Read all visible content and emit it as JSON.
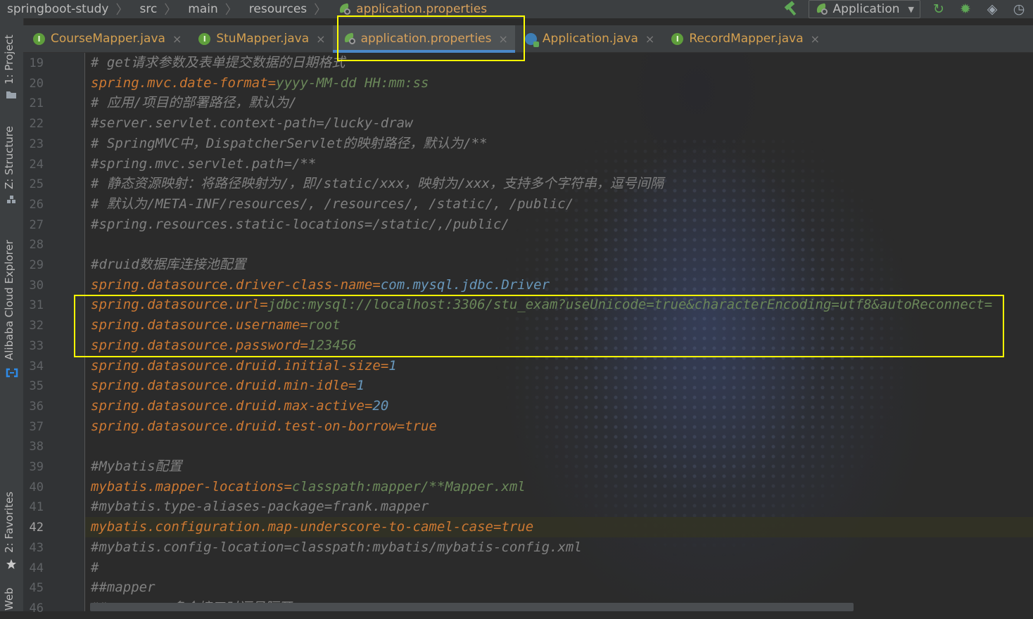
{
  "breadcrumb": {
    "items": [
      {
        "label": "springboot-study"
      },
      {
        "label": "src"
      },
      {
        "label": "main"
      },
      {
        "label": "resources"
      }
    ],
    "active": {
      "label": "application.properties",
      "icon": "spring-leaf-icon"
    }
  },
  "toolbar": {
    "build_icon": "hammer-icon",
    "run_config": {
      "label": "Application",
      "icon": "spring-leaf-icon"
    },
    "actions": [
      {
        "name": "rerun-icon",
        "glyph": "↻"
      },
      {
        "name": "debug-bug-icon",
        "glyph": "✹"
      },
      {
        "name": "coverage-shield-icon",
        "glyph": "◈"
      },
      {
        "name": "profiler-icon",
        "glyph": "◷"
      }
    ]
  },
  "tabs": [
    {
      "label": "CourseMapper.java",
      "icon": "interface-icon",
      "badge": "I",
      "active": false
    },
    {
      "label": "StuMapper.java",
      "icon": "interface-icon",
      "badge": "I",
      "active": false
    },
    {
      "label": "application.properties",
      "icon": "spring-leaf-icon",
      "active": true
    },
    {
      "label": "Application.java",
      "icon": "class-icon",
      "active": false
    },
    {
      "label": "RecordMapper.java",
      "icon": "interface-icon",
      "badge": "I",
      "active": false
    }
  ],
  "close_glyph": "×",
  "tool_windows": {
    "project": "1: Project",
    "structure": "Z: Structure",
    "alibaba": "Alibaba Cloud Explorer",
    "favorites": "2: Favorites",
    "web": "Web"
  },
  "editor": {
    "current_line": 42,
    "line_numbers": [
      19,
      20,
      21,
      22,
      23,
      24,
      25,
      26,
      27,
      28,
      29,
      30,
      31,
      32,
      33,
      34,
      35,
      36,
      37,
      38,
      39,
      40,
      41,
      42,
      43,
      44,
      45,
      46
    ],
    "lines": [
      {
        "type": "comment",
        "text": "# get请求参数及表单提交数据的日期格式"
      },
      {
        "type": "prop",
        "key": "spring.mvc.date-format",
        "value": "yyyy-MM-dd HH:mm:ss",
        "vclass": "v"
      },
      {
        "type": "comment",
        "text": "# 应用/项目的部署路径，默认为/"
      },
      {
        "type": "comment",
        "text": "#server.servlet.context-path=/lucky-draw"
      },
      {
        "type": "comment",
        "text": "# SpringMVC中，DispatcherServlet的映射路径，默认为/**"
      },
      {
        "type": "comment",
        "text": "#spring.mvc.servlet.path=/**"
      },
      {
        "type": "comment",
        "text": "# 静态资源映射：将路径映射为/，即/static/xxx，映射为/xxx，支持多个字符串，逗号间隔"
      },
      {
        "type": "comment",
        "text": "# 默认为/META-INF/resources/, /resources/, /static/, /public/"
      },
      {
        "type": "comment",
        "text": "#spring.resources.static-locations=/static/,/public/"
      },
      {
        "type": "blank",
        "text": ""
      },
      {
        "type": "comment",
        "text": "#druid数据库连接池配置"
      },
      {
        "type": "prop",
        "key": "spring.datasource.driver-class-name",
        "value": "com.mysql.jdbc.Driver",
        "vclass": "b"
      },
      {
        "type": "prop",
        "key": "spring.datasource.url",
        "value": "jdbc:mysql://localhost:3306/stu_exam?useUnicode=true&characterEncoding=utf8&autoReconnect=",
        "vclass": "v"
      },
      {
        "type": "prop",
        "key": "spring.datasource.username",
        "value": "root",
        "vclass": "v"
      },
      {
        "type": "prop",
        "key": "spring.datasource.password",
        "value": "123456",
        "vclass": "v"
      },
      {
        "type": "prop",
        "key": "spring.datasource.druid.initial-size",
        "value": "1",
        "vclass": "b"
      },
      {
        "type": "prop",
        "key": "spring.datasource.druid.min-idle",
        "value": "1",
        "vclass": "b"
      },
      {
        "type": "prop",
        "key": "spring.datasource.druid.max-active",
        "value": "20",
        "vclass": "b"
      },
      {
        "type": "prop",
        "key": "spring.datasource.druid.test-on-borrow",
        "value": "true",
        "vclass": "t"
      },
      {
        "type": "blank",
        "text": ""
      },
      {
        "type": "comment",
        "text": "#Mybatis配置"
      },
      {
        "type": "prop",
        "key": "mybatis.mapper-locations",
        "value": "classpath:mapper/**Mapper.xml",
        "vclass": "v"
      },
      {
        "type": "comment",
        "text": "#mybatis.type-aliases-package=frank.mapper"
      },
      {
        "type": "prop",
        "key": "mybatis.configuration.map-underscore-to-camel-case",
        "value": "true",
        "vclass": "t"
      },
      {
        "type": "comment",
        "text": "#mybatis.config-location=classpath:mybatis/mybatis-config.xml"
      },
      {
        "type": "comment",
        "text": "#"
      },
      {
        "type": "comment",
        "text": "##mapper"
      },
      {
        "type": "comment",
        "text": "##mappers 多个接口时逗号隔开"
      }
    ]
  }
}
